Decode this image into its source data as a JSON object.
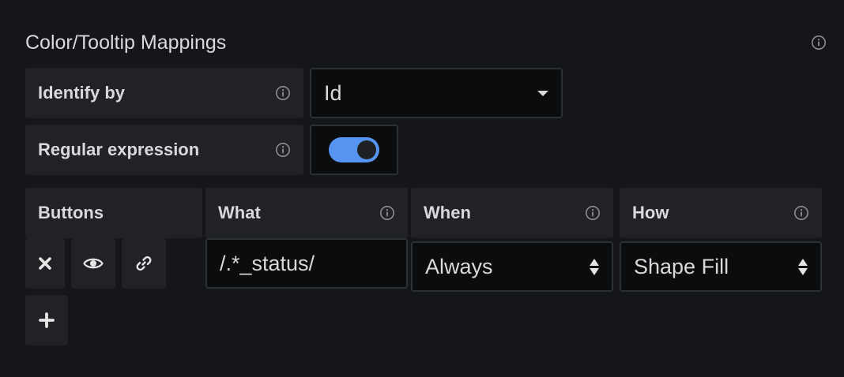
{
  "section": {
    "title": "Color/Tooltip Mappings",
    "info_icon": "info-icon"
  },
  "identify_by": {
    "label": "Identify by",
    "value": "Id",
    "icon": "chevron-down-icon"
  },
  "regular_expression": {
    "label": "Regular expression",
    "enabled": true
  },
  "columns": {
    "buttons": "Buttons",
    "what": "What",
    "when": "When",
    "how": "How"
  },
  "row": {
    "what_value": "/.*_status/",
    "when_value": "Always",
    "how_value": "Shape Fill",
    "buttons": [
      {
        "icon": "close-icon"
      },
      {
        "icon": "eye-icon"
      },
      {
        "icon": "link-icon"
      }
    ]
  },
  "add_button": {
    "icon": "plus-icon"
  },
  "colors": {
    "background": "#141619",
    "panel": "#202226",
    "field": "#0b0c0e",
    "accent": "#5794f2",
    "text": "#d8d9da"
  }
}
